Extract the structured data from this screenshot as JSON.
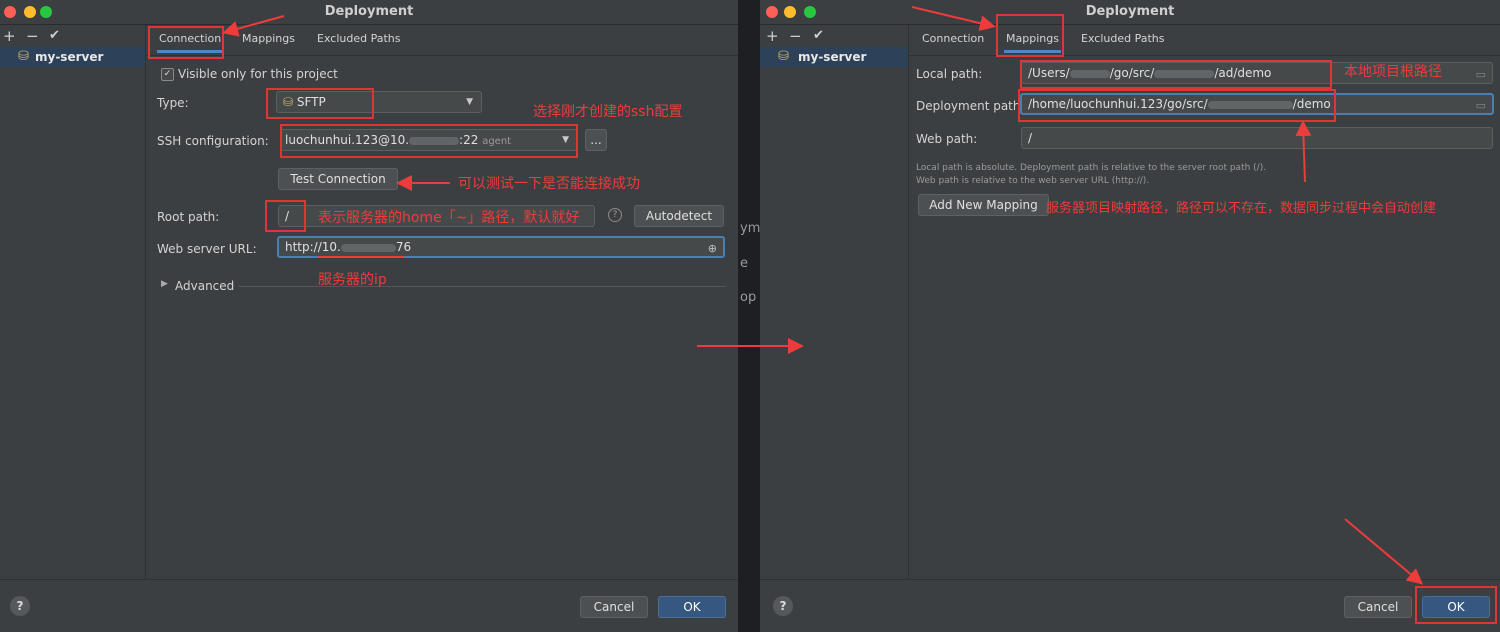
{
  "left_window": {
    "title": "Deployment",
    "server_name": "my-server",
    "tabs": [
      "Connection",
      "Mappings",
      "Excluded Paths"
    ],
    "visible_only_label": "Visible only for this project",
    "type_label": "Type:",
    "type_value": "SFTP",
    "ssh_label": "SSH configuration:",
    "ssh_value_prefix": "luochunhui.123@10.",
    "ssh_value_suffix": ":22",
    "ssh_agent": "agent",
    "more_btn": "...",
    "test_btn": "Test Connection",
    "root_label": "Root path:",
    "root_value": "/",
    "autodetect_btn": "Autodetect",
    "web_label": "Web server URL:",
    "web_value_prefix": "http://10.",
    "web_value_suffix": "76",
    "advanced_label": "Advanced",
    "cancel_btn": "Cancel",
    "ok_btn": "OK",
    "help": "?"
  },
  "right_window": {
    "title": "Deployment",
    "server_name": "my-server",
    "tabs": [
      "Connection",
      "Mappings",
      "Excluded Paths"
    ],
    "local_label": "Local path:",
    "local_value_prefix": "/Users/",
    "local_value_mid1": "/go/src/",
    "local_value_suffix": "/ad/demo",
    "deploy_label": "Deployment path:",
    "deploy_value_prefix": "/home/luochunhui.123/go/src/",
    "deploy_value_suffix": "/demo",
    "webpath_label": "Web path:",
    "webpath_value": "/",
    "note1": "Local path is absolute. Deployment path is relative to the server root path (/).",
    "note2": "Web path is relative to the web server URL (http://).",
    "add_mapping_btn": "Add New Mapping",
    "cancel_btn": "Cancel",
    "ok_btn": "OK",
    "help": "?"
  },
  "annotations": {
    "ssh_hint": "选择刚才创建的ssh配置",
    "test_hint": "可以测试一下是否能连接成功",
    "root_hint": "表示服务器的home「~」路径，默认就好",
    "ip_hint": "服务器的ip",
    "local_hint": "本地项目根路径",
    "deploy_hint": "服务器项目映射路径，路径可以不存在，数据同步过程中会自动创建"
  },
  "background_fragments": [
    "ym",
    "e",
    "op"
  ],
  "colors": {
    "annotation": "#ec3c3c",
    "accent": "#4a88c7",
    "window_bg": "#3c3f41",
    "selection": "#2d4159"
  }
}
